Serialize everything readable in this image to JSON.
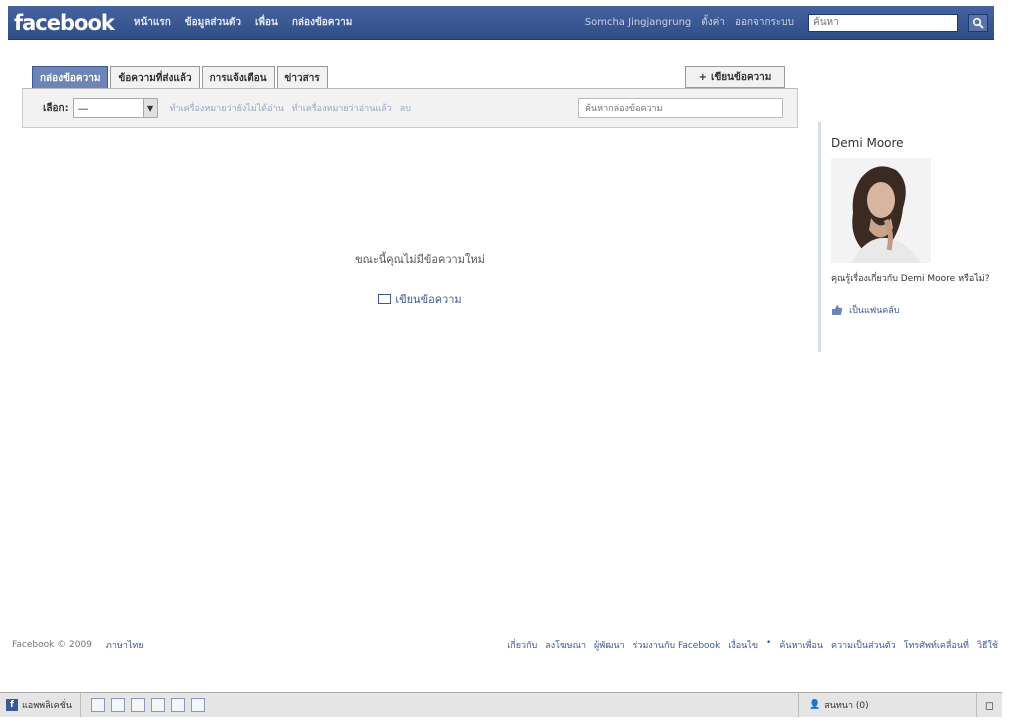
{
  "topbar": {
    "logo": "facebook",
    "nav": [
      "หน้าแรก",
      "ข้อมูลส่วนตัว",
      "เพื่อน",
      "กล่องข้อความ"
    ],
    "user_name": "Somcha Jingjangrung",
    "settings": "ตั้งค่า",
    "logout": "ออกจากระบบ",
    "search_placeholder": "ค้นหา"
  },
  "messages": {
    "tabs": [
      "กล่องข้อความ",
      "ข้อความที่ส่งแล้ว",
      "การแจ้งเตือน",
      "ข่าวสาร"
    ],
    "compose_label": "เขียนข้อความ",
    "compose_plus": "+",
    "filter_label": "เลือก:",
    "filter_value": "—",
    "filter_links": [
      "ทำเครื่องหมายว่ายังไม่ได้อ่าน",
      "ทำเครื่องหมายว่าอ่านแล้ว",
      "ลบ"
    ],
    "search_placeholder": "ค้นหากล่องข้อความ",
    "empty_text": "ขณะนี้คุณไม่มีข้อความใหม่",
    "compose_link": "เขียนข้อความ"
  },
  "ad": {
    "title": "Demi Moore",
    "question": "คุณรู้เรื่องเกี่ยวกับ Demi Moore หรือไม่?",
    "fan_link": "เป็นแฟนคลับ"
  },
  "footer": {
    "copyright": "Facebook © 2009",
    "language": "ภาษาไทย",
    "links": [
      "เกี่ยวกับ",
      "ลงโฆษณา",
      "ผู้พัฒนา",
      "ร่วมงานกับ Facebook",
      "เงื่อนไข",
      "•",
      "ค้นหาเพื่อน",
      "ความเป็นส่วนตัว",
      "โทรศัพท์เคลื่อนที่",
      "วิธีใช้"
    ]
  },
  "chatbar": {
    "applications": "แอพพลิเคชั่น",
    "online": "สนทนา (0)"
  },
  "colors": {
    "brand": "#3b5998",
    "active_tab": "#6d84b4"
  }
}
